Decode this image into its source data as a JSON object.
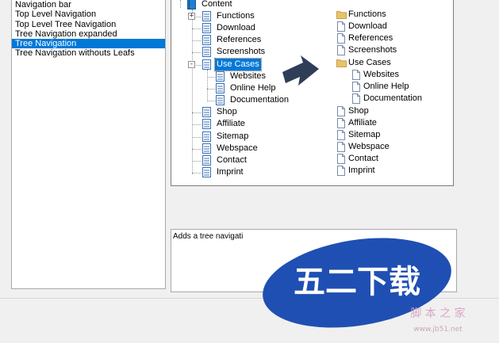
{
  "navigation_list": {
    "items": [
      {
        "label": "Navigation bar",
        "selected": false
      },
      {
        "label": "Top Level Navigation",
        "selected": false
      },
      {
        "label": "Top Level Tree Navigation",
        "selected": false
      },
      {
        "label": "Tree Navigation expanded",
        "selected": false
      },
      {
        "label": "Tree Navigation",
        "selected": true
      },
      {
        "label": "Tree Navigation withouts Leafs",
        "selected": false
      }
    ]
  },
  "tree_view": {
    "root": "Content",
    "items": [
      {
        "label": "Functions",
        "expander": "+"
      },
      {
        "label": "Download"
      },
      {
        "label": "References"
      },
      {
        "label": "Screenshots"
      },
      {
        "label": "Use Cases",
        "expander": "-",
        "selected": true
      },
      {
        "label": "Websites"
      },
      {
        "label": "Online Help"
      },
      {
        "label": "Documentation"
      },
      {
        "label": "Shop"
      },
      {
        "label": "Affiliate"
      },
      {
        "label": "Sitemap"
      },
      {
        "label": "Webspace"
      },
      {
        "label": "Contact"
      },
      {
        "label": "Imprint"
      }
    ]
  },
  "result_view": {
    "items": [
      {
        "label": "Functions",
        "icon": "folder-icon"
      },
      {
        "label": "Download",
        "icon": "page-icon"
      },
      {
        "label": "References",
        "icon": "page-icon"
      },
      {
        "label": "Screenshots",
        "icon": "page-icon"
      },
      {
        "label": "Use Cases",
        "icon": "folder-icon"
      },
      {
        "label": "Websites",
        "icon": "page-icon"
      },
      {
        "label": "Online Help",
        "icon": "page-icon"
      },
      {
        "label": "Documentation",
        "icon": "page-icon"
      },
      {
        "label": "Shop",
        "icon": "page-icon"
      },
      {
        "label": "Affiliate",
        "icon": "page-icon"
      },
      {
        "label": "Sitemap",
        "icon": "page-icon"
      },
      {
        "label": "Webspace",
        "icon": "page-icon"
      },
      {
        "label": "Contact",
        "icon": "page-icon"
      },
      {
        "label": "Imprint",
        "icon": "page-icon"
      }
    ]
  },
  "description": {
    "text": "Adds a tree navigati"
  },
  "watermark": {
    "title": "五二下载",
    "subtitle": "脚 本 之 家",
    "url": "www.jb51.net"
  },
  "colors": {
    "selection": "#0078d7",
    "folder": "#e8c36a",
    "arrow": "#2f3d57",
    "watermark_blue": "#1f4fb3"
  }
}
